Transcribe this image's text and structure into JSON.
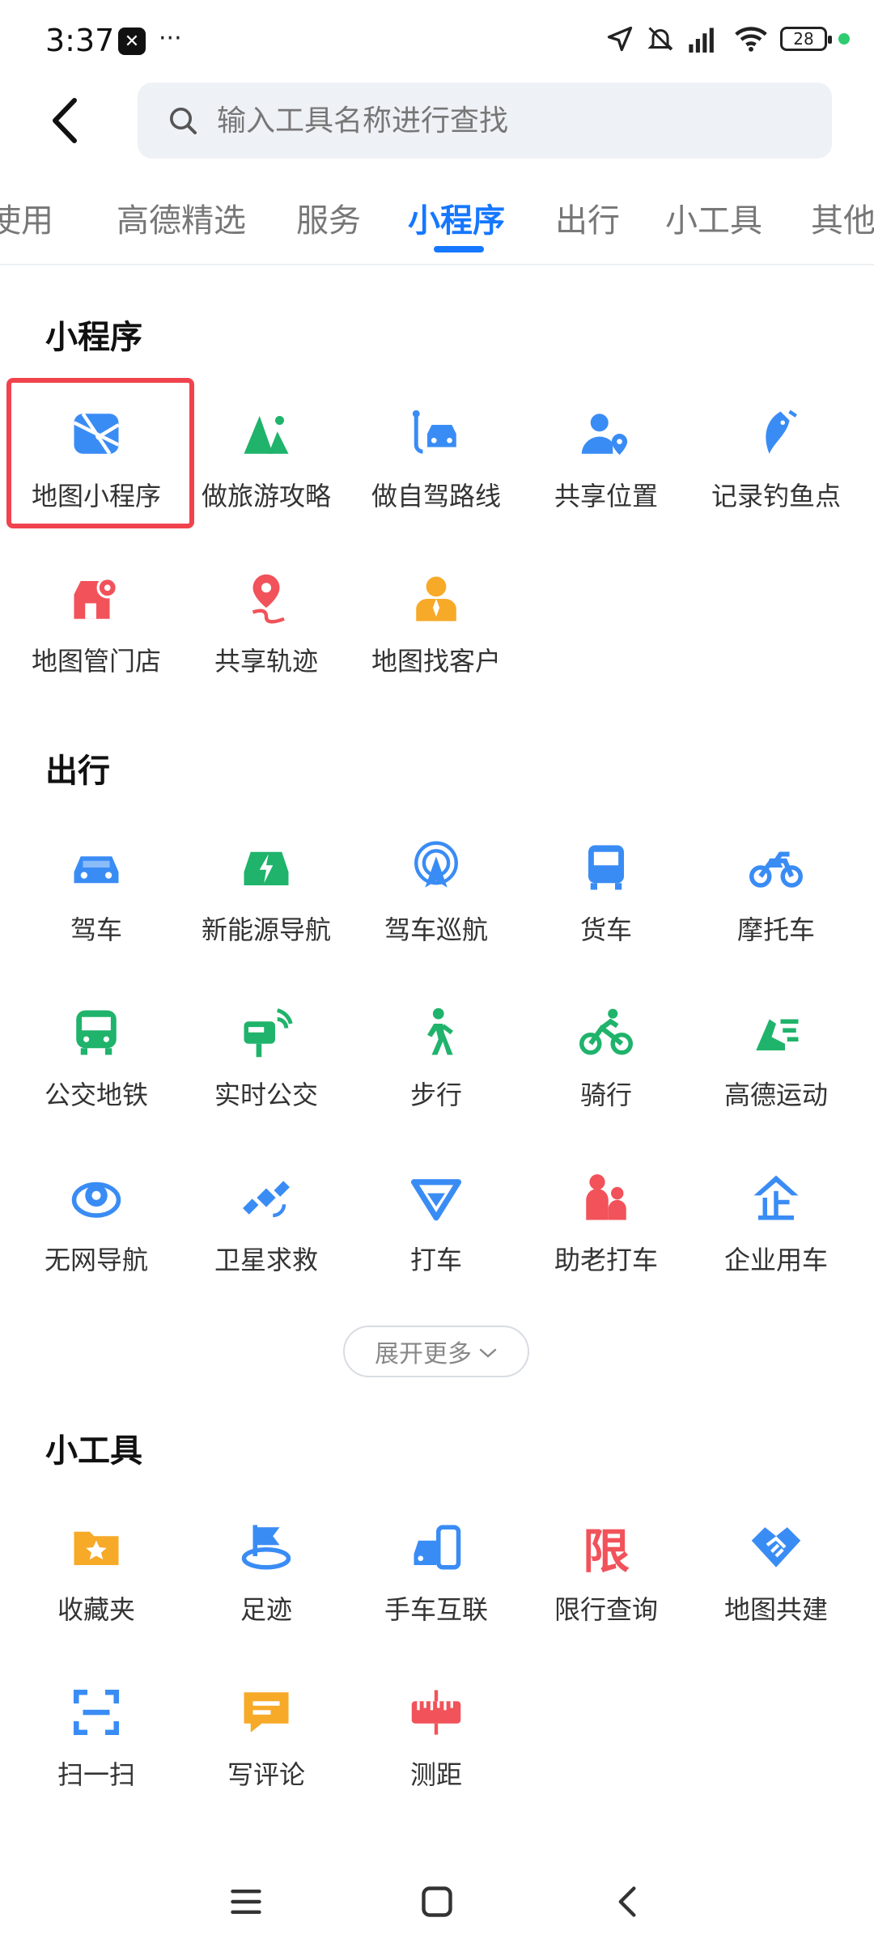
{
  "status_bar": {
    "time": "3:37",
    "app_badge": "⌘",
    "dots": "···",
    "battery": "28"
  },
  "search": {
    "placeholder": "输入工具名称进行查找"
  },
  "tabs": [
    "使用",
    "高德精选",
    "服务",
    "小程序",
    "出行",
    "小工具",
    "其他"
  ],
  "active_tab": "小程序",
  "sections": {
    "mini_programs": {
      "title": "小程序",
      "items": [
        "地图小程序",
        "做旅游攻略",
        "做自驾路线",
        "共享位置",
        "记录钓鱼点",
        "地图管门店",
        "共享轨迹",
        "地图找客户"
      ]
    },
    "travel": {
      "title": "出行",
      "items": [
        "驾车",
        "新能源导航",
        "驾车巡航",
        "货车",
        "摩托车",
        "公交地铁",
        "实时公交",
        "步行",
        "骑行",
        "高德运动",
        "无网导航",
        "卫星求救",
        "打车",
        "助老打车",
        "企业用车"
      ],
      "expand_label": "展开更多"
    },
    "tools": {
      "title": "小工具",
      "items": [
        "收藏夹",
        "足迹",
        "手车互联",
        "限行查询",
        "地图共建",
        "扫一扫",
        "写评论",
        "测距"
      ],
      "limit_glyph": "限"
    }
  },
  "colors": {
    "accent": "#1677ff",
    "highlight": "#f0434e",
    "green": "#1fb36b",
    "red": "#f2525a",
    "orange": "#f7a928"
  }
}
